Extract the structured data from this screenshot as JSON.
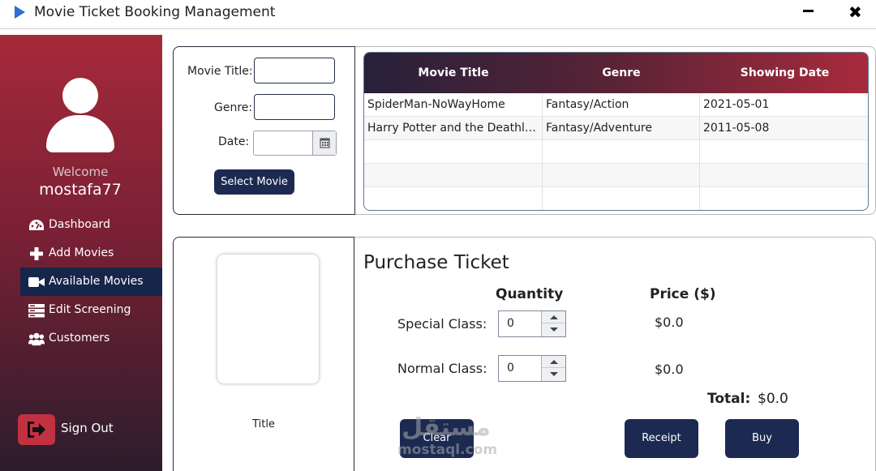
{
  "window": {
    "title": "Movie Ticket Booking Management"
  },
  "sidebar": {
    "welcome": "Welcome",
    "username": "mostafa77",
    "items": [
      {
        "label": "Dashboard",
        "icon": "dashboard-icon",
        "active": false
      },
      {
        "label": "Add Movies",
        "icon": "plus-icon",
        "active": false
      },
      {
        "label": "Available Movies",
        "icon": "video-camera-icon",
        "active": true
      },
      {
        "label": "Edit Screening",
        "icon": "server-icon",
        "active": false
      },
      {
        "label": "Customers",
        "icon": "users-icon",
        "active": false
      }
    ],
    "sign_out": "Sign Out"
  },
  "filter": {
    "movie_title_label": "Movie Title:",
    "movie_title_value": "",
    "genre_label": "Genre:",
    "genre_value": "",
    "date_label": "Date:",
    "date_value": "",
    "select_button": "Select Movie"
  },
  "movies_table": {
    "columns": [
      "Movie Title",
      "Genre",
      "Showing Date"
    ],
    "rows": [
      [
        "SpiderMan-NoWayHome",
        "Fantasy/Action",
        "2021-05-01"
      ],
      [
        "Harry Potter and the Deathly Hallows",
        "Fantasy/Adventure",
        "2011-05-08"
      ]
    ]
  },
  "poster": {
    "title": "Title"
  },
  "purchase": {
    "heading": "Purchase Ticket",
    "quantity_header": "Quantity",
    "price_header": "Price ($)",
    "special_label": "Special Class:",
    "special_qty": "0",
    "special_price": "$0.0",
    "normal_label": "Normal Class:",
    "normal_qty": "0",
    "normal_price": "$0.0",
    "total_label": "Total:",
    "total_value": "$0.0",
    "clear_button": "Clear",
    "receipt_button": "Receipt",
    "buy_button": "Buy"
  },
  "watermark": {
    "arabic": "مستقل",
    "latin": "mostaql.com"
  },
  "colors": {
    "sidebar_top": "#a52a3a",
    "sidebar_bottom": "#2b1d2c",
    "accent_navy": "#1c2a52",
    "active_nav": "#16254a",
    "header_gradient_start": "#26213a",
    "header_gradient_end": "#a82b3c",
    "sign_out_red": "#c23142"
  }
}
